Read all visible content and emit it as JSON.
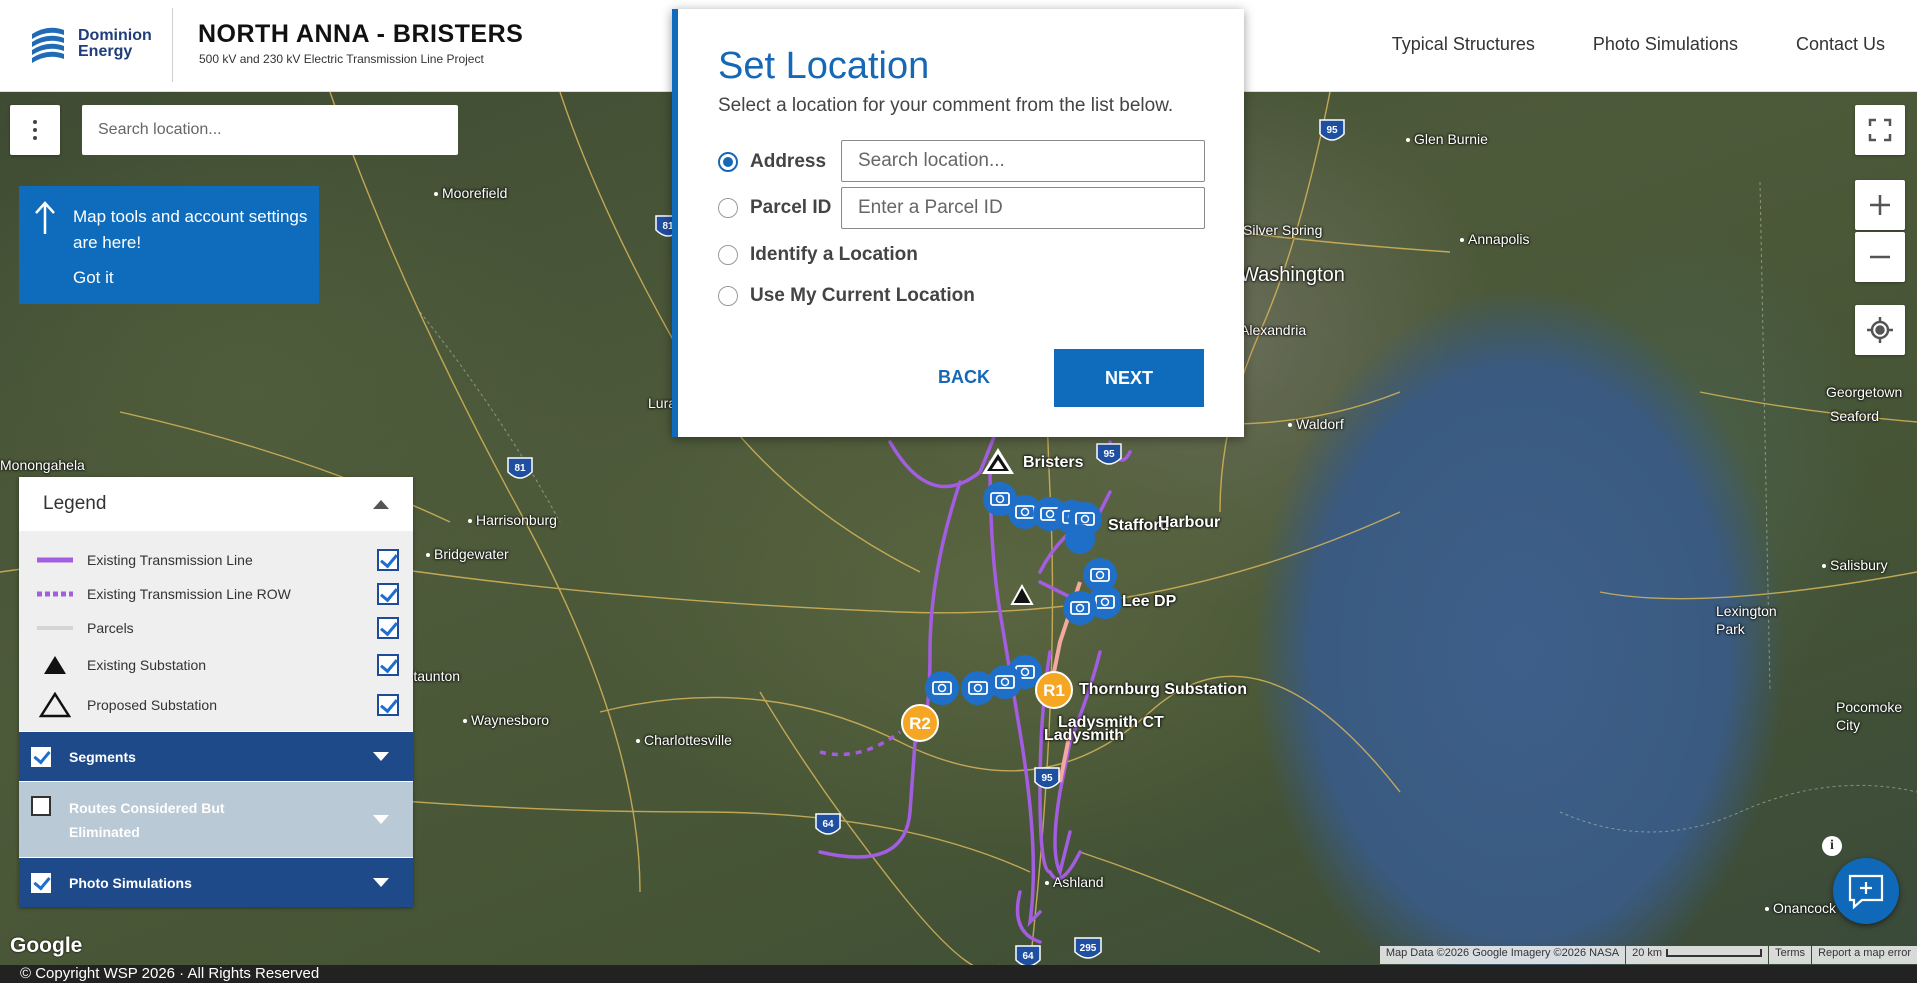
{
  "header": {
    "brand_line1": "Dominion",
    "brand_line2": "Energy",
    "project_title": "NORTH ANNA - BRISTERS",
    "project_subtitle": "500 kV and 230 kV Electric Transmission Line Project",
    "nav": [
      "Typical Structures",
      "Photo Simulations",
      "Contact Us"
    ]
  },
  "map": {
    "search_placeholder": "Search location...",
    "tip": {
      "text": "Map tools and account settings are here!",
      "action": "Got it"
    },
    "cities": [
      {
        "name": "Moorefield",
        "big": false
      },
      {
        "name": "Glen Burnie",
        "big": false
      },
      {
        "name": "Silver Spring",
        "big": false
      },
      {
        "name": "Annapolis",
        "big": false
      },
      {
        "name": "Washington",
        "big": true
      },
      {
        "name": "Alexandria",
        "big": false
      },
      {
        "name": "Waldorf",
        "big": false
      },
      {
        "name": "Georgetown",
        "big": false
      },
      {
        "name": "Seaford",
        "big": false
      },
      {
        "name": "Harrisonburg",
        "big": false
      },
      {
        "name": "Bridgewater",
        "big": false
      },
      {
        "name": "Stafford",
        "big": false
      },
      {
        "name": "Salisbury",
        "big": false
      },
      {
        "name": "Lexington Park",
        "big": false
      },
      {
        "name": "Waynesboro",
        "big": false
      },
      {
        "name": "Charlottesville",
        "big": false
      },
      {
        "name": "Pocomoke City",
        "big": false
      },
      {
        "name": "Ashland",
        "big": false
      },
      {
        "name": "Onancock",
        "big": false
      },
      {
        "name": "Monongahela",
        "big": false
      },
      {
        "name": "Luray",
        "big": false
      },
      {
        "name": "Staunton",
        "big": false
      }
    ],
    "route_labels": {
      "bristers": "Bristers",
      "harbour": "Harbour",
      "lee_dp": "Lee DP",
      "thornburg": "Thornburg Substation",
      "ladysmith_ct": "Ladysmith CT",
      "ladysmith": "Ladysmith",
      "r1": "R1",
      "r2": "R2"
    },
    "highway_shields": [
      "95",
      "81",
      "81",
      "95",
      "95",
      "64",
      "64",
      "295"
    ]
  },
  "legend": {
    "title": "Legend",
    "items": [
      {
        "label": "Existing Transmission Line",
        "symbol": "solid-purple-line-icon",
        "checked": true
      },
      {
        "label": "Existing Transmission Line ROW",
        "symbol": "dashed-purple-line-icon",
        "checked": true
      },
      {
        "label": "Parcels",
        "symbol": "gray-line-icon",
        "checked": true
      },
      {
        "label": "Existing Substation",
        "symbol": "filled-triangle-icon",
        "checked": true
      },
      {
        "label": "Proposed Substation",
        "symbol": "outline-triangle-icon",
        "checked": true
      }
    ],
    "sections": [
      {
        "label": "Segments",
        "checked": true,
        "style": "dark"
      },
      {
        "label": "Routes Considered But Eliminated",
        "checked": false,
        "style": "light"
      },
      {
        "label": "Photo Simulations",
        "checked": true,
        "style": "dark"
      }
    ]
  },
  "modal": {
    "title": "Set Location",
    "subtitle": "Select a location for your comment from the list below.",
    "options": [
      {
        "label": "Address",
        "selected": true,
        "input_placeholder": "Search location..."
      },
      {
        "label": "Parcel ID",
        "selected": false,
        "input_placeholder": "Enter a Parcel ID"
      },
      {
        "label": "Identify a Location",
        "selected": false
      },
      {
        "label": "Use My Current Location",
        "selected": false
      }
    ],
    "back_label": "BACK",
    "next_label": "NEXT"
  },
  "attribution": {
    "google": "Google",
    "map_data": "Map Data ©2026 Google Imagery ©2026 NASA",
    "scale": "20 km",
    "terms": "Terms",
    "report": "Report a map error"
  },
  "footer": {
    "copyright": "© Copyright WSP 2026 · All Rights Reserved"
  },
  "colors": {
    "brand_blue": "#0f6cbd",
    "legend_dark": "#1e4a8a",
    "legend_light": "#b9c9d6",
    "transmission_purple": "#a35de0",
    "marker_orange": "#f5a623"
  }
}
